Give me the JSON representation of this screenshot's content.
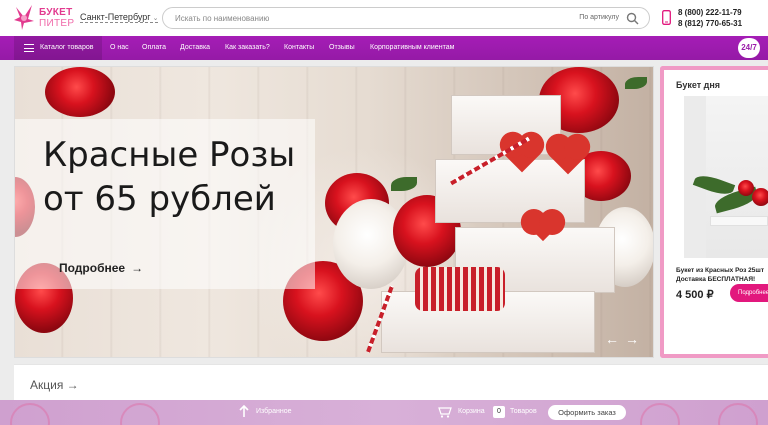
{
  "header": {
    "logo_line1": "БУКЕТ",
    "logo_line2": "ПИТЕР",
    "city": "Санкт-Петербург",
    "search_placeholder": "Искать по наименованию",
    "search_by_article": "По артикулу",
    "phone1": "8 (800) 222-11-79",
    "phone2": "8 (812) 770-65-31"
  },
  "nav": {
    "catalog": "Каталог товаров",
    "items": [
      "О нас",
      "Оплата",
      "Доставка",
      "Как заказать?",
      "Контакты",
      "Отзывы",
      "Корпоративным клиентам"
    ],
    "badge": "24/7"
  },
  "hero": {
    "title_line1": "Красные Розы",
    "title_line2": "от 65 рублей",
    "more": "Подробнее",
    "more_arrow": "→",
    "prev": "←",
    "next": "→"
  },
  "bouquet_of_day": {
    "title": "Букет дня",
    "product_line1": "Букет из Красных Роз 25шт",
    "product_line2": "Доставка БЕСПЛАТНАЯ!",
    "price": "4 500 ₽",
    "button": "Подробнее"
  },
  "promo": {
    "title": "Акция →"
  },
  "bottom_bar": {
    "favorites": "Избранное",
    "cart": "Корзина",
    "cart_count": "0",
    "goods": "Товаров",
    "order_button": "Оформить заказ"
  },
  "colors": {
    "nav": "#a01ab2",
    "accent": "#e2187d",
    "card_border": "#f09ac5"
  }
}
